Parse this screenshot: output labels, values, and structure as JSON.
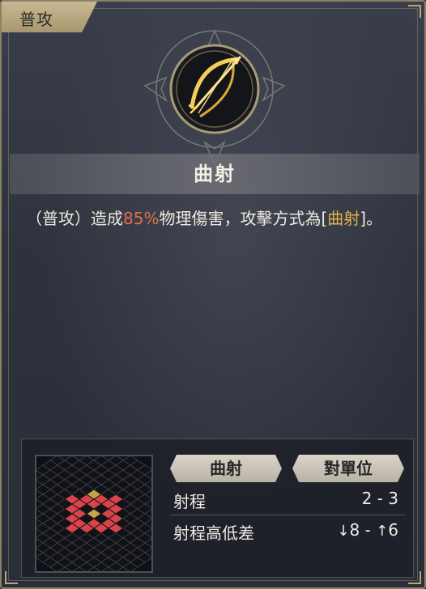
{
  "tag": {
    "label": "普攻"
  },
  "skill": {
    "icon": "bow-arrow-icon",
    "name": "曲射",
    "description": {
      "part1": "（普攻）造成",
      "percent": "85%",
      "part2": "物理傷害，攻擊方式為[",
      "attack_type": "曲射",
      "part3": "]。"
    }
  },
  "footer": {
    "attack_type_label": "曲射",
    "target_label": "對單位",
    "range": {
      "label": "射程",
      "value": "2 - 3"
    },
    "height_diff": {
      "label": "射程高低差",
      "down_arrow": "↓",
      "down_value": "8",
      "separator": "-",
      "up_arrow": "↑",
      "up_value": "6"
    }
  },
  "colors": {
    "accent_red": "#d9434c",
    "accent_gold": "#c7a24a",
    "highlight_orange": "#e07046",
    "highlight_gold": "#e2b24a"
  }
}
